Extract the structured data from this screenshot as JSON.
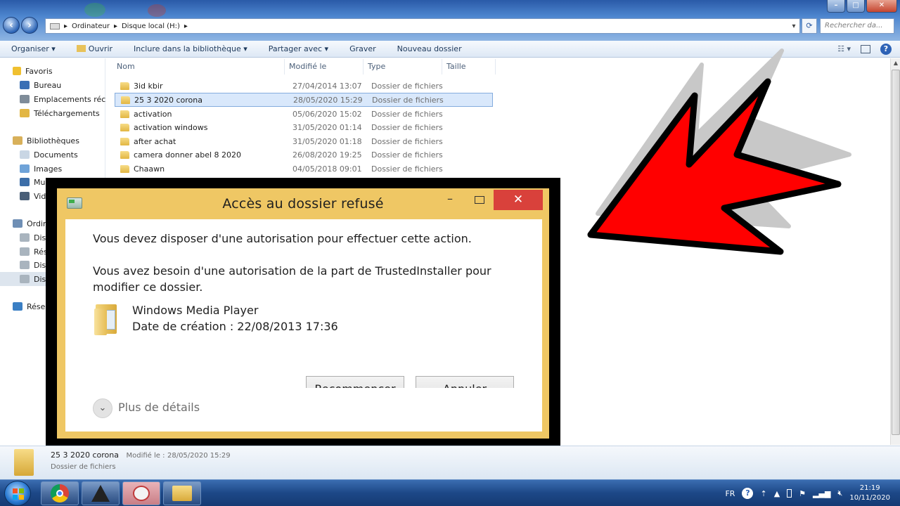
{
  "explorer": {
    "address_parts": [
      "Ordinateur",
      "Disque local (H:)"
    ],
    "search_placeholder": "Rechercher da...",
    "toolbar": {
      "organize": "Organiser ▾",
      "open": "Ouvrir",
      "include_library": "Inclure dans la bibliothèque ▾",
      "share": "Partager avec ▾",
      "burn": "Graver",
      "new_folder": "Nouveau dossier"
    },
    "sidebar": {
      "favorites": "Favoris",
      "desktop": "Bureau",
      "recent": "Emplacements récen",
      "downloads": "Téléchargements",
      "libraries": "Bibliothèques",
      "documents": "Documents",
      "images": "Images",
      "music": "Mu",
      "videos": "Vid",
      "computer": "Ordin",
      "disk1": "Dis",
      "network_share": "Rés",
      "disk2": "Dis",
      "disk3": "Dis",
      "network": "Résea"
    },
    "columns": {
      "name": "Nom",
      "modified": "Modifié le",
      "type": "Type",
      "size": "Taille"
    },
    "files": [
      {
        "name": "3id kbir",
        "date": "27/04/2014 13:07",
        "type": "Dossier de fichiers"
      },
      {
        "name": "25 3 2020 corona",
        "date": "28/05/2020 15:29",
        "type": "Dossier de fichiers"
      },
      {
        "name": "activation",
        "date": "05/06/2020 15:02",
        "type": "Dossier de fichiers"
      },
      {
        "name": "activation windows",
        "date": "31/05/2020 01:14",
        "type": "Dossier de fichiers"
      },
      {
        "name": "after achat",
        "date": "31/05/2020 01:18",
        "type": "Dossier de fichiers"
      },
      {
        "name": "camera donner abel 8 2020",
        "date": "26/08/2020 19:25",
        "type": "Dossier de fichiers"
      },
      {
        "name": "Chaawn",
        "date": "04/05/2018 09:01",
        "type": "Dossier de fichiers"
      }
    ],
    "details": {
      "name": "25 3 2020 corona",
      "modified_label": "Modifié le :",
      "modified_value": "28/05/2020 15:29",
      "type": "Dossier de fichiers"
    }
  },
  "dialog": {
    "title": "Accès au dossier refusé",
    "close_glyph": "✕",
    "message1": "Vous devez disposer d'une autorisation pour effectuer cette action.",
    "message2_line1": "Vous avez besoin d'une autorisation de la part de TrustedInstaller pour",
    "message2_line2": "modifier ce dossier.",
    "item_name": "Windows Media Player",
    "item_date": "Date de création : 22/08/2013 17:36",
    "retry_button": "Recommencer",
    "cancel_button": "Annuler",
    "more_details": "Plus de détails"
  },
  "taskbar": {
    "language": "FR",
    "time": "21:19",
    "date": "10/11/2020"
  },
  "colors": {
    "dialog_accent": "#efc764",
    "close_red": "#d9413b",
    "arrow_red": "#ff0000"
  }
}
